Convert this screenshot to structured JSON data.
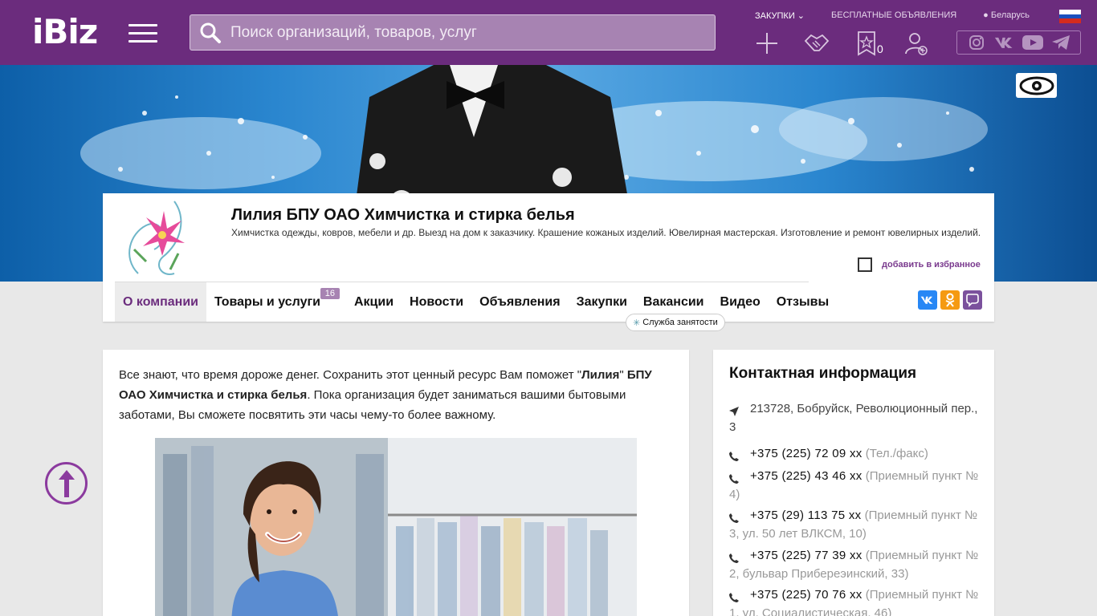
{
  "header": {
    "logo": "iBiz",
    "search_placeholder": "Поиск организаций, товаров, услуг",
    "links": {
      "zakupki": "ЗАКУПКИ",
      "free_ads": "БЕСПЛАТНЫЕ ОБЪЯВЛЕНИЯ",
      "region": "Беларусь"
    },
    "favorites_count": "0",
    "icons": [
      "plus-icon",
      "handshake-icon",
      "star-bookmark-icon",
      "add-user-icon"
    ],
    "socials": [
      "instagram-icon",
      "vk-icon",
      "youtube-icon",
      "telegram-icon"
    ],
    "colors": {
      "brand": "#6b2c7d",
      "search_bg": "#a783b2"
    }
  },
  "company": {
    "title": "Лилия БПУ ОАО Химчистка и стирка белья",
    "description": "Химчистка одежды, ковров, мебели и др. Выезд на дом к заказчику. Крашение кожаных изделий. Ювелирная мастерская. Изготовление и ремонт ювелирных изделий.",
    "add_favorite": "добавить в избранное"
  },
  "tabs": [
    {
      "label": "О компании",
      "active": true
    },
    {
      "label": "Товары и услуги",
      "badge": "16"
    },
    {
      "label": "Акции"
    },
    {
      "label": "Новости"
    },
    {
      "label": "Объявления"
    },
    {
      "label": "Закупки"
    },
    {
      "label": "Вакансии"
    },
    {
      "label": "Видео"
    },
    {
      "label": "Отзывы"
    }
  ],
  "sluzhba_label": "Служба занятости",
  "share": [
    "vk-icon",
    "odnoklassniki-icon",
    "viber-icon"
  ],
  "main": {
    "intro_1": "Все знают, что время дороже денег. Сохранить этот ценный ресурс Вам поможет  \"",
    "intro_bold_1": "Лилия",
    "intro_2": "\" ",
    "intro_bold_2": "БПУ ОАО Химчистка и стирка белья",
    "intro_3": ".  Пока организация будет заниматься вашими бытовыми заботами, Вы сможете посвятить эти часы чему-то более важному."
  },
  "contacts": {
    "title": "Контактная информация",
    "address": "213728, Бобруйск, Революционный пер., 3",
    "phones": [
      {
        "number": "+375 (225) 72 09 xx",
        "note": "(Тел./факс)"
      },
      {
        "number": "+375 (225) 43 46 xx",
        "note": "(Приемный пункт № 4)"
      },
      {
        "number": "+375 (29) 113 75 xx",
        "note": "(Приемный пункт № 3, ул. 50 лет ВЛКСМ, 10)"
      },
      {
        "number": "+375 (225) 77 39 xx",
        "note": "(Приемный пункт № 2, бульвар Прибереэинский, 33)"
      },
      {
        "number": "+375 (225) 70 76 xx",
        "note": "(Приемный пункт № 1, ул. Социалистическая, 46)"
      }
    ]
  }
}
